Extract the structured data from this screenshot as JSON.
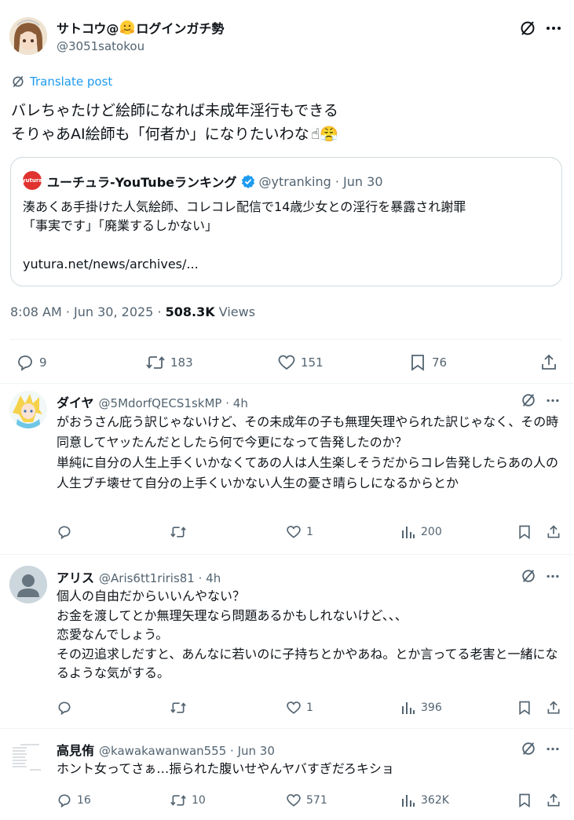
{
  "post": {
    "author_name": "サトコウ@",
    "author_name_suffix": "ログインガチ勢",
    "author_handle": "@3051satokou",
    "translate_label": "Translate post",
    "text": "バレちゃたけど絵師になれば未成年淫行もできる\nそりゃあAI絵師も「何者か」になりたいわな",
    "emoji": "☝😤",
    "quote": {
      "logo_text": "yutura",
      "name": "ユーチュラ-YouTubeランキング",
      "handle_date": "@ytranking · Jun 30",
      "text": "湊あくあ手掛けた人気絵師、コレコレ配信で14歳少女との淫行を暴露され謝罪\n「事実です」「廃業するしかない」",
      "link": "yutura.net/news/archives/..."
    },
    "timestamp": "8:08 AM · Jun 30, 2025 · ",
    "views_count": "508.3K",
    "views_label": " Views",
    "stats": {
      "replies": "9",
      "reposts": "183",
      "likes": "151",
      "bookmarks": "76"
    }
  },
  "replies": [
    {
      "name": "ダイヤ",
      "handle": "@5MdorfQECS1skMP · 4h",
      "text": "がおうさん庇う訳じゃないけど、その未成年の子も無理矢理やられた訳じゃなく、その時同意してヤッたんだとしたら何で今更になって告発したのか？\n単純に自分の人生上手くいかなくてあの人は人生楽しそうだからコレ告発したらあの人の人生ブチ壊せて自分の上手くいかない人生の憂さ晴らしになるからとか",
      "reply_count": "",
      "repost_count": "",
      "like_count": "1",
      "view_count": "200"
    },
    {
      "name": "アリス",
      "handle": "@Aris6tt1riris81 · 4h",
      "text": "個人の自由だからいいんやない？\nお金を渡してとか無理矢理なら問題あるかもしれないけど、、、\n恋愛なんでしょう。\nその辺追求しだすと、あんなに若いのに子持ちとかやあね。とか言ってる老害と一緒になるような気がする。",
      "reply_count": "",
      "repost_count": "",
      "like_count": "1",
      "view_count": "396"
    },
    {
      "name": "高見侑",
      "handle": "@kawakawanwan555 · Jun 30",
      "text": "ホント女ってさぁ…振られた腹いせやんヤバすぎだろキショ",
      "reply_count": "16",
      "repost_count": "10",
      "like_count": "571",
      "view_count": "362K"
    }
  ],
  "colors": {
    "text": "#0f1419",
    "secondary": "#536471",
    "link": "#1d9bf0",
    "verified": "#1d9bf0",
    "yutura_red": "#e0322f",
    "divider": "#eff3f4"
  },
  "icons": [
    "grok-icon",
    "more-icon",
    "translate-icon",
    "verified-icon",
    "reply-icon",
    "repost-icon",
    "like-icon",
    "bookmark-icon",
    "share-icon",
    "views-icon"
  ]
}
